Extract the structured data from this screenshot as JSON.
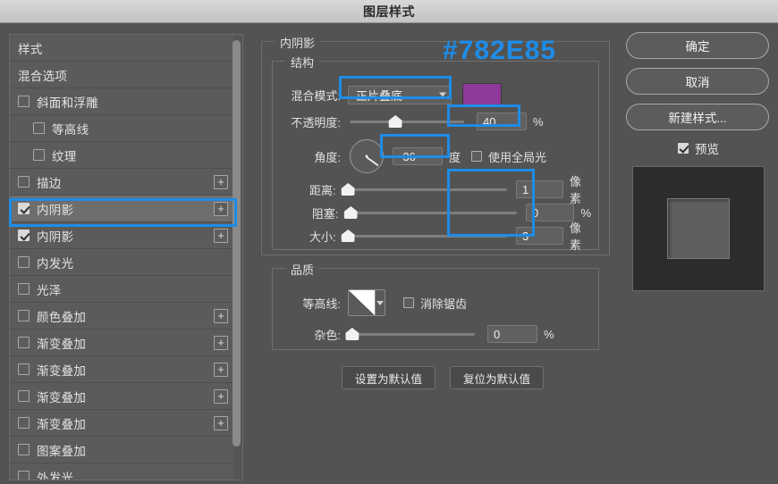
{
  "window": {
    "title": "图层样式"
  },
  "sidebar": {
    "scrollbar": "vertical-scrollbar",
    "items": [
      {
        "label": "样式",
        "checkbox": "none",
        "plus": false,
        "sub": false,
        "selected": false
      },
      {
        "label": "混合选项",
        "checkbox": "none",
        "plus": false,
        "sub": false,
        "selected": false
      },
      {
        "label": "斜面和浮雕",
        "checkbox": "unchecked",
        "plus": false,
        "sub": false,
        "selected": false
      },
      {
        "label": "等高线",
        "checkbox": "unchecked",
        "plus": false,
        "sub": true,
        "selected": false
      },
      {
        "label": "纹理",
        "checkbox": "unchecked",
        "plus": false,
        "sub": true,
        "selected": false
      },
      {
        "label": "描边",
        "checkbox": "unchecked",
        "plus": true,
        "sub": false,
        "selected": false
      },
      {
        "label": "内阴影",
        "checkbox": "checked",
        "plus": true,
        "sub": false,
        "selected": true
      },
      {
        "label": "内阴影",
        "checkbox": "checked",
        "plus": true,
        "sub": false,
        "selected": false
      },
      {
        "label": "内发光",
        "checkbox": "unchecked",
        "plus": false,
        "sub": false,
        "selected": false
      },
      {
        "label": "光泽",
        "checkbox": "unchecked",
        "plus": false,
        "sub": false,
        "selected": false
      },
      {
        "label": "颜色叠加",
        "checkbox": "unchecked",
        "plus": true,
        "sub": false,
        "selected": false
      },
      {
        "label": "渐变叠加",
        "checkbox": "unchecked",
        "plus": true,
        "sub": false,
        "selected": false
      },
      {
        "label": "渐变叠加",
        "checkbox": "unchecked",
        "plus": true,
        "sub": false,
        "selected": false
      },
      {
        "label": "渐变叠加",
        "checkbox": "unchecked",
        "plus": true,
        "sub": false,
        "selected": false
      },
      {
        "label": "渐变叠加",
        "checkbox": "unchecked",
        "plus": true,
        "sub": false,
        "selected": false
      },
      {
        "label": "图案叠加",
        "checkbox": "unchecked",
        "plus": false,
        "sub": false,
        "selected": false
      },
      {
        "label": "外发光",
        "checkbox": "unchecked",
        "plus": false,
        "sub": false,
        "selected": false
      }
    ],
    "plus_label": "+"
  },
  "main": {
    "group_title": "内阴影",
    "structure": {
      "title": "结构",
      "blend_mode": {
        "label": "混合模式:",
        "value": "正片叠底"
      },
      "color_swatch": "#8E3A9A",
      "opacity": {
        "label": "不透明度:",
        "value": "40",
        "unit": "%",
        "percent": 40
      },
      "angle": {
        "label": "角度:",
        "value": "-36",
        "unit": "度",
        "degrees": -36
      },
      "global_light": {
        "label": "使用全局光",
        "checked": false
      },
      "distance": {
        "label": "距离:",
        "value": "1",
        "unit": "像素",
        "percent": 0
      },
      "choke": {
        "label": "阻塞:",
        "value": "0",
        "unit": "%",
        "percent": 0
      },
      "size": {
        "label": "大小:",
        "value": "3",
        "unit": "像素",
        "percent": 0
      }
    },
    "quality": {
      "title": "品质",
      "contour": {
        "label": "等高线:"
      },
      "anti_alias": {
        "label": "消除锯齿",
        "checked": false
      },
      "noise": {
        "label": "杂色:",
        "value": "0",
        "unit": "%",
        "percent": 0
      }
    },
    "buttons": {
      "set_default": "设置为默认值",
      "reset_default": "复位为默认值"
    }
  },
  "right": {
    "ok": "确定",
    "cancel": "取消",
    "new_style": "新建样式...",
    "preview": {
      "label": "预览",
      "checked": true
    }
  },
  "annotations": {
    "hex_color": "#782E85",
    "accent": "#1E8CE8"
  }
}
